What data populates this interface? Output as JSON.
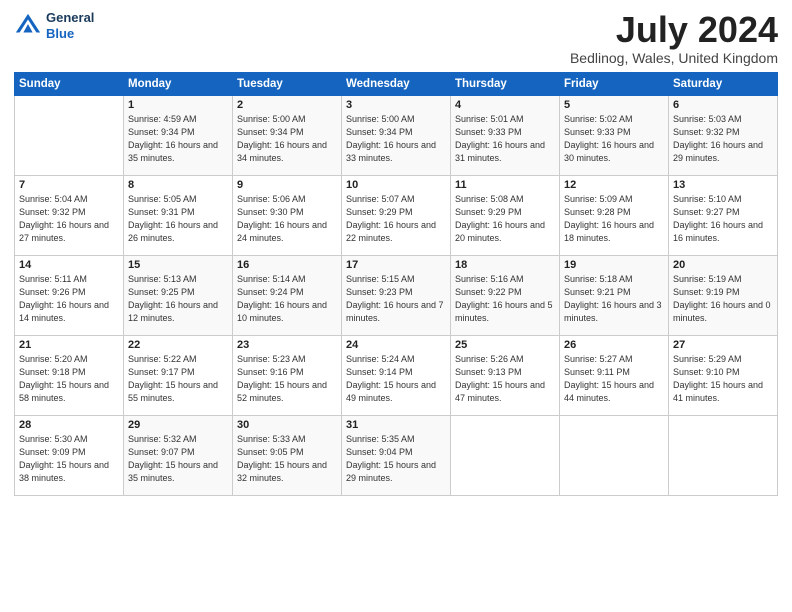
{
  "header": {
    "logo_line1": "General",
    "logo_line2": "Blue",
    "month_title": "July 2024",
    "location": "Bedlinog, Wales, United Kingdom"
  },
  "days_of_week": [
    "Sunday",
    "Monday",
    "Tuesday",
    "Wednesday",
    "Thursday",
    "Friday",
    "Saturday"
  ],
  "weeks": [
    [
      {
        "day": "",
        "sunrise": "",
        "sunset": "",
        "daylight": ""
      },
      {
        "day": "1",
        "sunrise": "Sunrise: 4:59 AM",
        "sunset": "Sunset: 9:34 PM",
        "daylight": "Daylight: 16 hours and 35 minutes."
      },
      {
        "day": "2",
        "sunrise": "Sunrise: 5:00 AM",
        "sunset": "Sunset: 9:34 PM",
        "daylight": "Daylight: 16 hours and 34 minutes."
      },
      {
        "day": "3",
        "sunrise": "Sunrise: 5:00 AM",
        "sunset": "Sunset: 9:34 PM",
        "daylight": "Daylight: 16 hours and 33 minutes."
      },
      {
        "day": "4",
        "sunrise": "Sunrise: 5:01 AM",
        "sunset": "Sunset: 9:33 PM",
        "daylight": "Daylight: 16 hours and 31 minutes."
      },
      {
        "day": "5",
        "sunrise": "Sunrise: 5:02 AM",
        "sunset": "Sunset: 9:33 PM",
        "daylight": "Daylight: 16 hours and 30 minutes."
      },
      {
        "day": "6",
        "sunrise": "Sunrise: 5:03 AM",
        "sunset": "Sunset: 9:32 PM",
        "daylight": "Daylight: 16 hours and 29 minutes."
      }
    ],
    [
      {
        "day": "7",
        "sunrise": "Sunrise: 5:04 AM",
        "sunset": "Sunset: 9:32 PM",
        "daylight": "Daylight: 16 hours and 27 minutes."
      },
      {
        "day": "8",
        "sunrise": "Sunrise: 5:05 AM",
        "sunset": "Sunset: 9:31 PM",
        "daylight": "Daylight: 16 hours and 26 minutes."
      },
      {
        "day": "9",
        "sunrise": "Sunrise: 5:06 AM",
        "sunset": "Sunset: 9:30 PM",
        "daylight": "Daylight: 16 hours and 24 minutes."
      },
      {
        "day": "10",
        "sunrise": "Sunrise: 5:07 AM",
        "sunset": "Sunset: 9:29 PM",
        "daylight": "Daylight: 16 hours and 22 minutes."
      },
      {
        "day": "11",
        "sunrise": "Sunrise: 5:08 AM",
        "sunset": "Sunset: 9:29 PM",
        "daylight": "Daylight: 16 hours and 20 minutes."
      },
      {
        "day": "12",
        "sunrise": "Sunrise: 5:09 AM",
        "sunset": "Sunset: 9:28 PM",
        "daylight": "Daylight: 16 hours and 18 minutes."
      },
      {
        "day": "13",
        "sunrise": "Sunrise: 5:10 AM",
        "sunset": "Sunset: 9:27 PM",
        "daylight": "Daylight: 16 hours and 16 minutes."
      }
    ],
    [
      {
        "day": "14",
        "sunrise": "Sunrise: 5:11 AM",
        "sunset": "Sunset: 9:26 PM",
        "daylight": "Daylight: 16 hours and 14 minutes."
      },
      {
        "day": "15",
        "sunrise": "Sunrise: 5:13 AM",
        "sunset": "Sunset: 9:25 PM",
        "daylight": "Daylight: 16 hours and 12 minutes."
      },
      {
        "day": "16",
        "sunrise": "Sunrise: 5:14 AM",
        "sunset": "Sunset: 9:24 PM",
        "daylight": "Daylight: 16 hours and 10 minutes."
      },
      {
        "day": "17",
        "sunrise": "Sunrise: 5:15 AM",
        "sunset": "Sunset: 9:23 PM",
        "daylight": "Daylight: 16 hours and 7 minutes."
      },
      {
        "day": "18",
        "sunrise": "Sunrise: 5:16 AM",
        "sunset": "Sunset: 9:22 PM",
        "daylight": "Daylight: 16 hours and 5 minutes."
      },
      {
        "day": "19",
        "sunrise": "Sunrise: 5:18 AM",
        "sunset": "Sunset: 9:21 PM",
        "daylight": "Daylight: 16 hours and 3 minutes."
      },
      {
        "day": "20",
        "sunrise": "Sunrise: 5:19 AM",
        "sunset": "Sunset: 9:19 PM",
        "daylight": "Daylight: 16 hours and 0 minutes."
      }
    ],
    [
      {
        "day": "21",
        "sunrise": "Sunrise: 5:20 AM",
        "sunset": "Sunset: 9:18 PM",
        "daylight": "Daylight: 15 hours and 58 minutes."
      },
      {
        "day": "22",
        "sunrise": "Sunrise: 5:22 AM",
        "sunset": "Sunset: 9:17 PM",
        "daylight": "Daylight: 15 hours and 55 minutes."
      },
      {
        "day": "23",
        "sunrise": "Sunrise: 5:23 AM",
        "sunset": "Sunset: 9:16 PM",
        "daylight": "Daylight: 15 hours and 52 minutes."
      },
      {
        "day": "24",
        "sunrise": "Sunrise: 5:24 AM",
        "sunset": "Sunset: 9:14 PM",
        "daylight": "Daylight: 15 hours and 49 minutes."
      },
      {
        "day": "25",
        "sunrise": "Sunrise: 5:26 AM",
        "sunset": "Sunset: 9:13 PM",
        "daylight": "Daylight: 15 hours and 47 minutes."
      },
      {
        "day": "26",
        "sunrise": "Sunrise: 5:27 AM",
        "sunset": "Sunset: 9:11 PM",
        "daylight": "Daylight: 15 hours and 44 minutes."
      },
      {
        "day": "27",
        "sunrise": "Sunrise: 5:29 AM",
        "sunset": "Sunset: 9:10 PM",
        "daylight": "Daylight: 15 hours and 41 minutes."
      }
    ],
    [
      {
        "day": "28",
        "sunrise": "Sunrise: 5:30 AM",
        "sunset": "Sunset: 9:09 PM",
        "daylight": "Daylight: 15 hours and 38 minutes."
      },
      {
        "day": "29",
        "sunrise": "Sunrise: 5:32 AM",
        "sunset": "Sunset: 9:07 PM",
        "daylight": "Daylight: 15 hours and 35 minutes."
      },
      {
        "day": "30",
        "sunrise": "Sunrise: 5:33 AM",
        "sunset": "Sunset: 9:05 PM",
        "daylight": "Daylight: 15 hours and 32 minutes."
      },
      {
        "day": "31",
        "sunrise": "Sunrise: 5:35 AM",
        "sunset": "Sunset: 9:04 PM",
        "daylight": "Daylight: 15 hours and 29 minutes."
      },
      {
        "day": "",
        "sunrise": "",
        "sunset": "",
        "daylight": ""
      },
      {
        "day": "",
        "sunrise": "",
        "sunset": "",
        "daylight": ""
      },
      {
        "day": "",
        "sunrise": "",
        "sunset": "",
        "daylight": ""
      }
    ]
  ]
}
